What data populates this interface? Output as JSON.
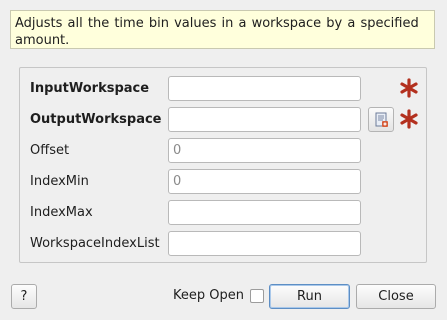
{
  "dialog": {
    "description": "Adjusts all the time bin values in a workspace by a specified amount."
  },
  "properties": [
    {
      "label": "InputWorkspace",
      "value": "",
      "placeholder": "",
      "mandatory": true,
      "bold": true,
      "browse": false
    },
    {
      "label": "OutputWorkspace",
      "value": "",
      "placeholder": "",
      "mandatory": true,
      "bold": true,
      "browse": true
    },
    {
      "label": "Offset",
      "value": "",
      "placeholder": "0",
      "mandatory": false,
      "bold": false,
      "browse": false
    },
    {
      "label": "IndexMin",
      "value": "",
      "placeholder": "0",
      "mandatory": false,
      "bold": false,
      "browse": false
    },
    {
      "label": "IndexMax",
      "value": "",
      "placeholder": "",
      "mandatory": false,
      "bold": false,
      "browse": false
    },
    {
      "label": "WorkspaceIndexList",
      "value": "",
      "placeholder": "",
      "mandatory": false,
      "bold": false,
      "browse": false
    }
  ],
  "footer": {
    "help_label": "?",
    "keep_open_label": "Keep Open",
    "keep_open_checked": false,
    "run_label": "Run",
    "close_label": "Close"
  },
  "colors": {
    "mandatory_star": "#b3301e",
    "description_bg": "#ffffdc"
  },
  "icons": {
    "mandatory": "asterisk-icon",
    "browse": "workspace-browse-icon"
  }
}
